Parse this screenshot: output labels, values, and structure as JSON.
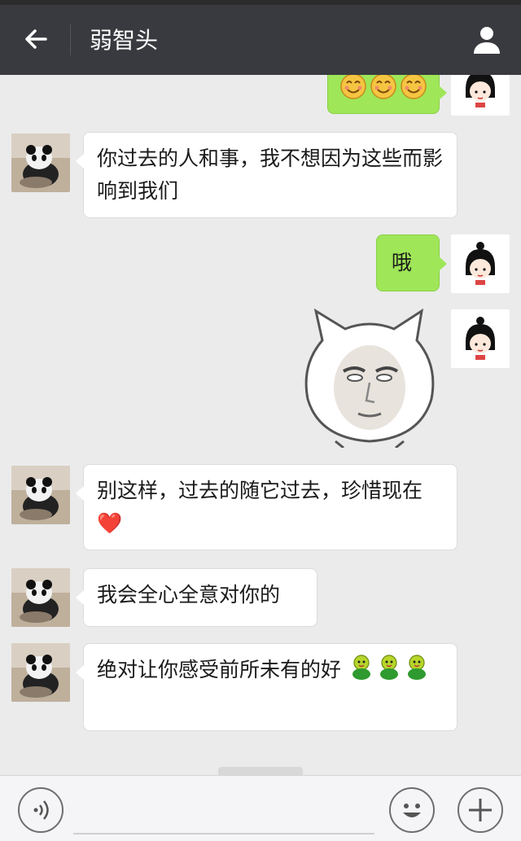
{
  "header": {
    "title": "弱智头",
    "back_icon": "arrow-left-icon",
    "profile_icon": "person-icon"
  },
  "messages": [
    {
      "side": "right",
      "type": "emoji",
      "content": "😊😊😊"
    },
    {
      "side": "left",
      "type": "text",
      "content": "你过去的人和事，我不想因为这些而影响到我们"
    },
    {
      "side": "right",
      "type": "text",
      "content": "哦"
    },
    {
      "side": "right",
      "type": "sticker",
      "content": "cat-face-sticker"
    },
    {
      "side": "left",
      "type": "text",
      "content": "别这样，过去的随它过去，珍惜现在❤️"
    },
    {
      "side": "left",
      "type": "text",
      "content": "我会全心全意对你的"
    },
    {
      "side": "left",
      "type": "text",
      "content": "绝对让你感受前所未有的好"
    }
  ],
  "input": {
    "voice_icon": "voice-icon",
    "emoji_icon": "emoji-icon",
    "plus_icon": "plus-icon"
  },
  "colors": {
    "titlebar": "#393a3f",
    "sent_bubble": "#9fe658",
    "received_bubble": "#ffffff",
    "background": "#ebebeb"
  }
}
